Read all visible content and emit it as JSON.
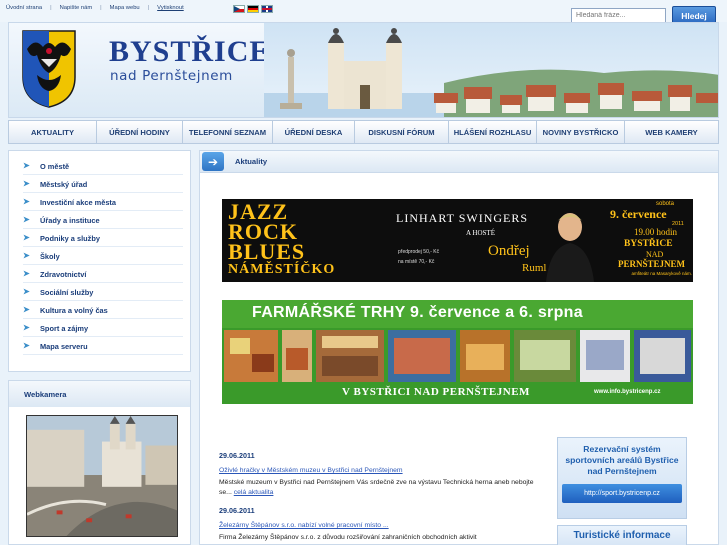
{
  "toplinks": [
    "Úvodní strana",
    "Napište nám",
    "Mapa webu",
    "Vytisknout"
  ],
  "languages": [
    "cz",
    "de",
    "en"
  ],
  "search": {
    "placeholder": "Hledaná fráze...",
    "button": "Hledej"
  },
  "header": {
    "title": "BYSTŘICE",
    "subtitle": "nad Pernštejnem"
  },
  "nav": [
    "AKTUALITY",
    "ÚŘEDNÍ HODINY",
    "TELEFONNÍ SEZNAM",
    "ÚŘEDNÍ DESKA",
    "DISKUSNÍ FÓRUM",
    "HLÁŠENÍ ROZHLASU",
    "NOVINY BYSTŘICKO",
    "WEB KAMERY"
  ],
  "sidebar": {
    "items": [
      "O městě",
      "Městský úřad",
      "Investiční akce města",
      "Úřady a instituce",
      "Podniky a služby",
      "Školy",
      "Zdravotnictví",
      "Sociální služby",
      "Kultura a volný čas",
      "Sport a zájmy",
      "Mapa serveru"
    ]
  },
  "webcam": {
    "title": "Webkamera"
  },
  "content": {
    "title": "Aktuality"
  },
  "banner_jazz": {
    "words": [
      "JAZZ",
      "ROCK",
      "BLUES",
      "NÁMĚSTÍČKO"
    ],
    "band": "LINHART SWINGERS",
    "guests": "A HOSTÉ",
    "guest_name": "Ondřej",
    "guest_surname": "Ruml",
    "weekday": "sobota",
    "date": "9. července",
    "year": "2011",
    "time": "19.00 hodin",
    "place1": "BYSTŘICE",
    "place2": "NAD",
    "place3": "PERNŠTEJNEM",
    "place_note": "amfiteátr na Masarykově nám.",
    "presale": "předprodej 50,- Kč",
    "atdoor": "na místě 70,- Kč"
  },
  "banner_farm": {
    "title": "FARMÁŘSKÉ TRHY 9. července a 6. srpna",
    "bottom": "V BYSTŘICI NAD PERNŠTEJNEM",
    "url": "www.info.bystricenp.cz"
  },
  "news": [
    {
      "date": "29.06.2011",
      "title": "Oživlé hračky v Městském muzeu v Bystřici nad Pernštejnem",
      "text": "Městské muzeum v Bystřici nad Pernštejnem Vás srdečně zve na výstavu Technická herna aneb nebojte se...",
      "more": "celá aktualita"
    },
    {
      "date": "29.06.2011",
      "title": "Železárny Štěpánov s.r.o. nabízí volné pracovní místo ...",
      "text": "Firma Železárny Štěpánov s.r.o. z důvodu rozšiřování zahraničních obchodních aktivit"
    }
  ],
  "promo_rez": {
    "title": "Rezervační systém sportovních areálů Bystřice nad Pernštejnem",
    "link": "http://sport.bystricenp.cz"
  },
  "promo_tur": {
    "title": "Turistické informace"
  },
  "colors": {
    "brand": "#1f3f8f",
    "link": "#2a56b8",
    "accent": "#3b8ec9"
  }
}
